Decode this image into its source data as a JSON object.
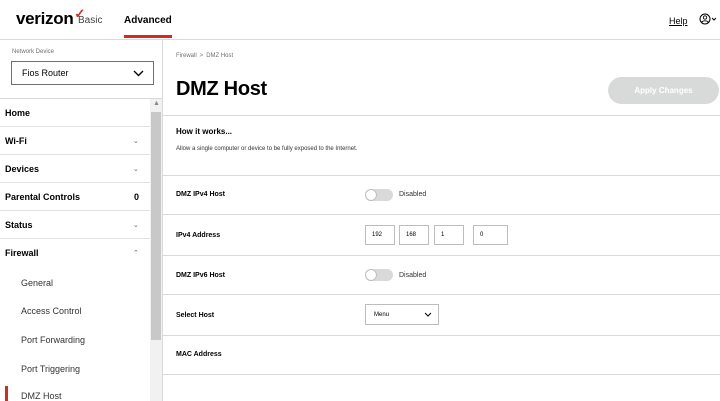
{
  "brand": {
    "logo_text": "verizon",
    "logo_mark": "✓",
    "accent": "#d52b1e"
  },
  "topnav": {
    "tabs": [
      "Basic",
      "Advanced"
    ],
    "active_tab": "Advanced",
    "help_label": "Help",
    "user_icon": "user-circle-icon"
  },
  "sidebar": {
    "network_device_label": "Network Device",
    "network_device_value": "Fios Router",
    "items": [
      {
        "label": "Home"
      },
      {
        "label": "Wi-Fi",
        "caret": "⌄"
      },
      {
        "label": "Devices",
        "caret": "⌄"
      },
      {
        "label": "Parental Controls",
        "count": "0"
      },
      {
        "label": "Status",
        "caret": "⌄"
      },
      {
        "label": "Firewall",
        "caret": "⌃"
      }
    ],
    "subitems": [
      {
        "label": "General"
      },
      {
        "label": "Access Control"
      },
      {
        "label": "Port Forwarding"
      },
      {
        "label": "Port Triggering"
      },
      {
        "label": "DMZ Host"
      }
    ],
    "active_subitem": "DMZ Host"
  },
  "main": {
    "breadcrumb": [
      "Firewall",
      "DMZ Host"
    ],
    "breadcrumb_sep": ">",
    "title": "DMZ Host",
    "apply_label": "Apply Changes",
    "how_title": "How it works...",
    "how_text": "Allow a single computer or device to be fully exposed to the Internet.",
    "rows": {
      "ipv4_host": {
        "label": "DMZ IPv4 Host",
        "state": "Disabled"
      },
      "ipv4_address": {
        "label": "IPv4 Address",
        "octets": [
          "192",
          "168",
          "1",
          "0"
        ]
      },
      "ipv6_host": {
        "label": "DMZ IPv6 Host",
        "state": "Disabled"
      },
      "select_host": {
        "label": "Select Host",
        "value": "Menu"
      },
      "mac_address": {
        "label": "MAC Address"
      }
    }
  }
}
